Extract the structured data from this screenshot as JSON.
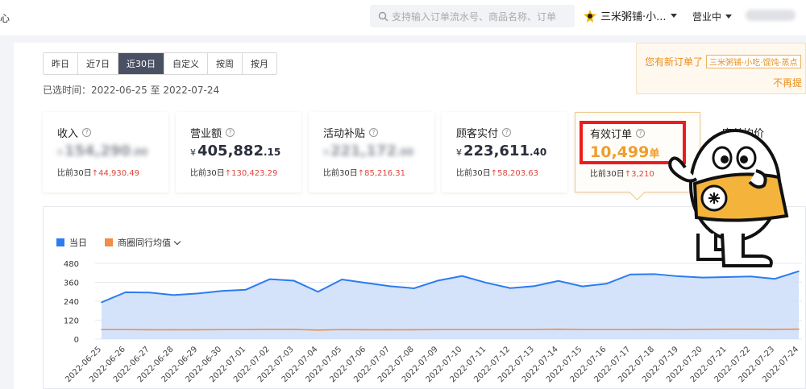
{
  "topbar": {
    "left_glyph": "心",
    "search_placeholder": "支持输入订单流水号、商品名称、订单",
    "store_name": "三米粥铺·小...",
    "status": "营业中"
  },
  "range_tabs": [
    "昨日",
    "近7日",
    "近30日",
    "自定义",
    "按周",
    "按月"
  ],
  "active_tab": "近30日",
  "selected_range": "已选时间：2022-06-25 至 2022-07-24",
  "notice": {
    "text": "您有新订单了",
    "store_tag": "三米粥铺·小吃·馄饨·蒸点",
    "action": "不再提"
  },
  "cards": [
    {
      "label": "收入",
      "currency": "¥",
      "int": "154,290",
      "dec": ".00",
      "blurred": true,
      "cmp_prefix": "比前30日",
      "cmp_value": "44,930.49"
    },
    {
      "label": "营业额",
      "currency": "¥",
      "int": "405,882",
      "dec": ".15",
      "blurred": false,
      "cmp_prefix": "比前30日",
      "cmp_value": "130,423.29"
    },
    {
      "label": "活动补贴",
      "currency": "¥",
      "int": "221,172",
      "dec": ".00",
      "blurred": true,
      "cmp_prefix": "比前30日",
      "cmp_value": "85,216.31"
    },
    {
      "label": "顾客实付",
      "currency": "¥",
      "int": "223,611",
      "dec": ".40",
      "blurred": false,
      "cmp_prefix": "比前30日",
      "cmp_value": "58,203.63"
    },
    {
      "label": "有效订单",
      "currency": "",
      "int": "10,499",
      "dec": "",
      "unit": "单",
      "blurred": false,
      "cmp_prefix": "比前30日",
      "cmp_value": "3,210"
    }
  ],
  "card6_label": "客单均价",
  "chart_data": {
    "type": "area",
    "x": [
      "2022-06-25",
      "2022-06-26",
      "2022-06-27",
      "2022-06-28",
      "2022-06-29",
      "2022-06-30",
      "2022-07-01",
      "2022-07-02",
      "2022-07-03",
      "2022-07-04",
      "2022-07-05",
      "2022-07-06",
      "2022-07-07",
      "2022-07-08",
      "2022-07-09",
      "2022-07-10",
      "2022-07-11",
      "2022-07-12",
      "2022-07-13",
      "2022-07-14",
      "2022-07-15",
      "2022-07-16",
      "2022-07-17",
      "2022-07-18",
      "2022-07-19",
      "2022-07-20",
      "2022-07-21",
      "2022-07-22",
      "2022-07-23",
      "2022-07-24"
    ],
    "series": [
      {
        "name": "当日",
        "color": "#2b7cf0",
        "values": [
          233,
          297,
          295,
          279,
          289,
          305,
          313,
          380,
          370,
          300,
          378,
          356,
          335,
          322,
          371,
          400,
          357,
          323,
          336,
          369,
          334,
          351,
          410,
          412,
          398,
          390,
          393,
          397,
          382,
          430
        ]
      },
      {
        "name": "商圈同行均值",
        "color": "#f08d49",
        "values": [
          60,
          60,
          59,
          59,
          59,
          60,
          60,
          61,
          61,
          57,
          60,
          59,
          59,
          59,
          60,
          60,
          60,
          60,
          60,
          62,
          60,
          60,
          60,
          61,
          60,
          61,
          62,
          62,
          61,
          63
        ]
      }
    ],
    "yticks": [
      0,
      120,
      240,
      360,
      480
    ],
    "ylim": [
      0,
      480
    ]
  }
}
